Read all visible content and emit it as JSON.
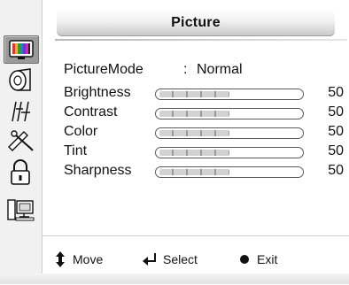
{
  "header": {
    "title": "Picture"
  },
  "sidebar": {
    "items": [
      {
        "name": "picture-menu-icon",
        "active": true
      },
      {
        "name": "sound-menu-icon",
        "active": false
      },
      {
        "name": "channel-menu-icon",
        "active": false
      },
      {
        "name": "setup-menu-icon",
        "active": false
      },
      {
        "name": "lock-menu-icon",
        "active": false
      },
      {
        "name": "pc-menu-icon",
        "active": false
      }
    ]
  },
  "picture_mode": {
    "label": "PictureMode",
    "separator": ":",
    "value": "Normal"
  },
  "settings": [
    {
      "label": "Brightness",
      "value": "50",
      "level": 0.5
    },
    {
      "label": "Contrast",
      "value": "50",
      "level": 0.5
    },
    {
      "label": "Color",
      "value": "50",
      "level": 0.5
    },
    {
      "label": "Tint",
      "value": "50",
      "level": 0.5
    },
    {
      "label": "Sharpness",
      "value": "50",
      "level": 0.5
    }
  ],
  "footer": {
    "move_label": "Move",
    "select_label": "Select",
    "exit_label": "Exit"
  },
  "colors": {
    "accent": "#9a9a9a",
    "text": "#111111",
    "background": "#ffffff"
  }
}
